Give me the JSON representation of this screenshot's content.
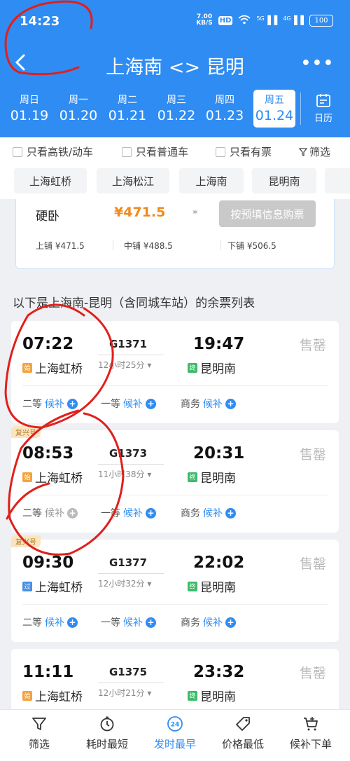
{
  "status_bar": {
    "time": "14:23",
    "speed_value": "7.00",
    "speed_unit": "KB/S",
    "hd": "HD",
    "net1": "5G",
    "net2": "4G",
    "battery": "100"
  },
  "header": {
    "title": "上海南 <> 昆明"
  },
  "dates": [
    {
      "week": "周日",
      "date": "01.19"
    },
    {
      "week": "周一",
      "date": "01.20"
    },
    {
      "week": "周二",
      "date": "01.21"
    },
    {
      "week": "周三",
      "date": "01.22"
    },
    {
      "week": "周四",
      "date": "01.23"
    },
    {
      "week": "周五",
      "date": "01.24"
    }
  ],
  "calendar_label": "日历",
  "filters": {
    "hsr": "只看高铁/动车",
    "normal": "只看普通车",
    "available": "只看有票",
    "filter": "筛选"
  },
  "stations": [
    "上海虹桥",
    "上海松江",
    "上海南",
    "昆明南"
  ],
  "seat_card": {
    "name": "硬卧",
    "price": "¥471.5",
    "star": "*",
    "buy": "按预填信息购票",
    "berths": [
      "上铺 ¥471.5",
      "中铺 ¥488.5",
      "下铺 ¥506.5"
    ]
  },
  "list_title": "以下是上海南-昆明（含同城车站）的余票列表",
  "trains": [
    {
      "dep": "07:22",
      "no": "G1371",
      "arr": "19:47",
      "dur": "12小时25分",
      "from_tag": "始",
      "from": "上海虹桥",
      "to_tag": "终",
      "to": "昆明南",
      "status": "售罄",
      "badge": "",
      "seats": [
        {
          "cls": "二等",
          "wl": "候补"
        },
        {
          "cls": "一等",
          "wl": "候补"
        },
        {
          "cls": "商务",
          "wl": "候补"
        }
      ]
    },
    {
      "dep": "08:53",
      "no": "G1373",
      "arr": "20:31",
      "dur": "11小时38分",
      "from_tag": "始",
      "from": "上海虹桥",
      "to_tag": "终",
      "to": "昆明南",
      "status": "售罄",
      "badge": "复兴号",
      "seats": [
        {
          "cls": "二等",
          "wl": "候补"
        },
        {
          "cls": "一等",
          "wl": "候补"
        },
        {
          "cls": "商务",
          "wl": "候补"
        }
      ]
    },
    {
      "dep": "09:30",
      "no": "G1377",
      "arr": "22:02",
      "dur": "12小时32分",
      "from_tag": "过",
      "from": "上海虹桥",
      "to_tag": "终",
      "to": "昆明南",
      "status": "售罄",
      "badge": "复兴号",
      "seats": [
        {
          "cls": "二等",
          "wl": "候补"
        },
        {
          "cls": "一等",
          "wl": "候补"
        },
        {
          "cls": "商务",
          "wl": "候补"
        }
      ]
    },
    {
      "dep": "11:11",
      "no": "G1375",
      "arr": "23:32",
      "dur": "12小时21分",
      "from_tag": "始",
      "from": "上海虹桥",
      "to_tag": "终",
      "to": "昆明南",
      "status": "售罄",
      "badge": ""
    }
  ],
  "bottom_nav": [
    {
      "label": "筛选",
      "icon": "filter-icon"
    },
    {
      "label": "耗时最短",
      "icon": "timer-icon"
    },
    {
      "label": "发时最早",
      "icon": "clock-24-icon"
    },
    {
      "label": "价格最低",
      "icon": "price-tag-icon"
    },
    {
      "label": "候补下单",
      "icon": "cart-add-icon"
    }
  ],
  "colors": {
    "primary": "#2f8cf2",
    "price": "#f08a1c",
    "annotation": "#e0201c"
  }
}
